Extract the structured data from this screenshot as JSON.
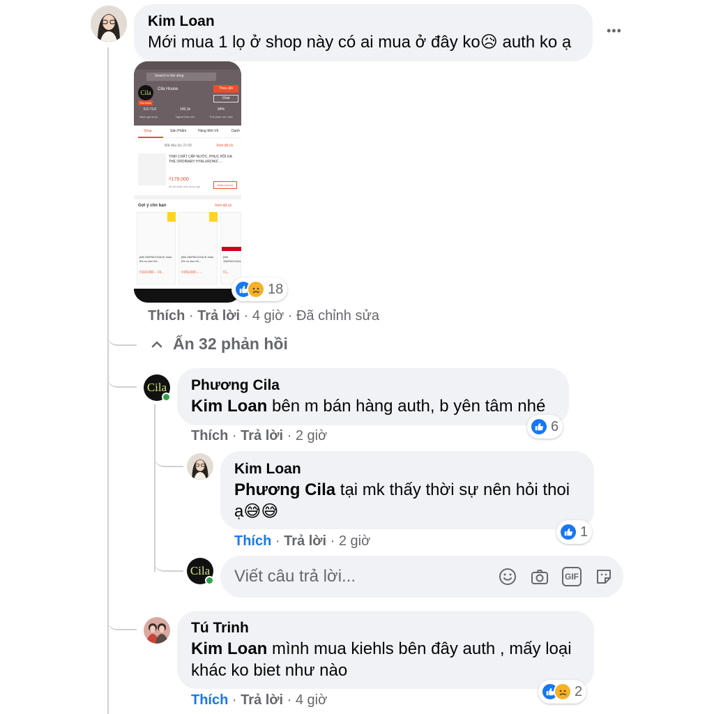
{
  "top_comment": {
    "author": "Kim Loan",
    "text": "Mới mua 1 lọ ở shop này có ai mua ở đây ko",
    "text_after_emoji": " auth ko ạ",
    "emoji": "😥",
    "more_label": "•••",
    "reaction_count": "18",
    "actions": {
      "like": "Thích",
      "reply": "Trả lời",
      "time": "4 giờ",
      "edited": "Đã chỉnh sửa"
    },
    "attachment": {
      "search_placeholder": "Search in the shop",
      "shop_name": "Cila House",
      "badge": "Yêu thích",
      "follow_label": "Theo dõi",
      "chat_label": "Chat",
      "stats": [
        {
          "value": "5.0 / 5.0",
          "label": "Đánh giá shop"
        },
        {
          "value": "145,1k",
          "label": "Người theo dõi"
        },
        {
          "value": "94%",
          "label": "Tỉ lệ phản hồi Chat"
        }
      ],
      "tabs": [
        "Shop",
        "Sản Phẩm",
        "Hàng Mới Về",
        "Danh"
      ],
      "flash_start": "Bắt đầu lúc 21:00",
      "see_all": "Xem tất cả",
      "product_name": "TINH CHẤT CẤP NƯỚC, PHỤC HỒI DA THE ORDINARY HYALURONIC ...",
      "product_price": "₫179.000",
      "product_remind": "Nhắc nhở tôi",
      "product_note": "26 lời nhắc nhở được tạo",
      "suggest_title": "Gợi ý cho bạn",
      "grid_items": [
        {
          "title": "[Mã 156FMCGSALE hoàn 8% xu đơn 50...",
          "price": "₫119.000 – ₫3..."
        },
        {
          "title": "[Mã 156FMCGSALE hoàn 8% xu đơn 50...",
          "price": "₫159.000 – ..."
        },
        {
          "title": "[Mã 156FMCGSALE hoàn 8% xu đơn 50...",
          "price": "₫1..."
        }
      ]
    }
  },
  "hide_replies": "Ẩn 32 phản hồi",
  "replies": [
    {
      "author": "Phương Cila",
      "mention": "Kim Loan",
      "text": " bên m bán hàng auth, b yên tâm nhé",
      "reaction_count": "6",
      "actions": {
        "like": "Thích",
        "reply": "Trả lời",
        "time": "2 giờ"
      }
    },
    {
      "author": "Kim Loan",
      "mention": "Phương Cila",
      "text": " tại mk thấy thời sự nên hỏi thoi",
      "text_line2": "ạ😅😅",
      "reaction_count": "1",
      "actions": {
        "like": "Thích",
        "reply": "Trả lời",
        "time": "2 giờ"
      }
    },
    {
      "author": "Tú Trinh",
      "mention": "Kim Loan",
      "text": " mình mua kiehls bên đây auth , mấy loại",
      "text_line2": "khác ko biet như nào",
      "reaction_count": "2",
      "actions": {
        "like": "Thích",
        "reply": "Trả lời",
        "time": "4 giờ"
      }
    }
  ],
  "reply_box": {
    "placeholder": "Viết câu trả lời...",
    "icons": [
      "emoji-icon",
      "camera-icon",
      "gif-icon",
      "sticker-icon"
    ],
    "gif_label": "GIF"
  },
  "logo_text": "Cila",
  "colors": {
    "like_blue": "#1877f2",
    "bubble": "#f0f2f5",
    "meta_gray": "#65676b",
    "online": "#31a24c",
    "shopee_orange": "#ee4d2d"
  }
}
